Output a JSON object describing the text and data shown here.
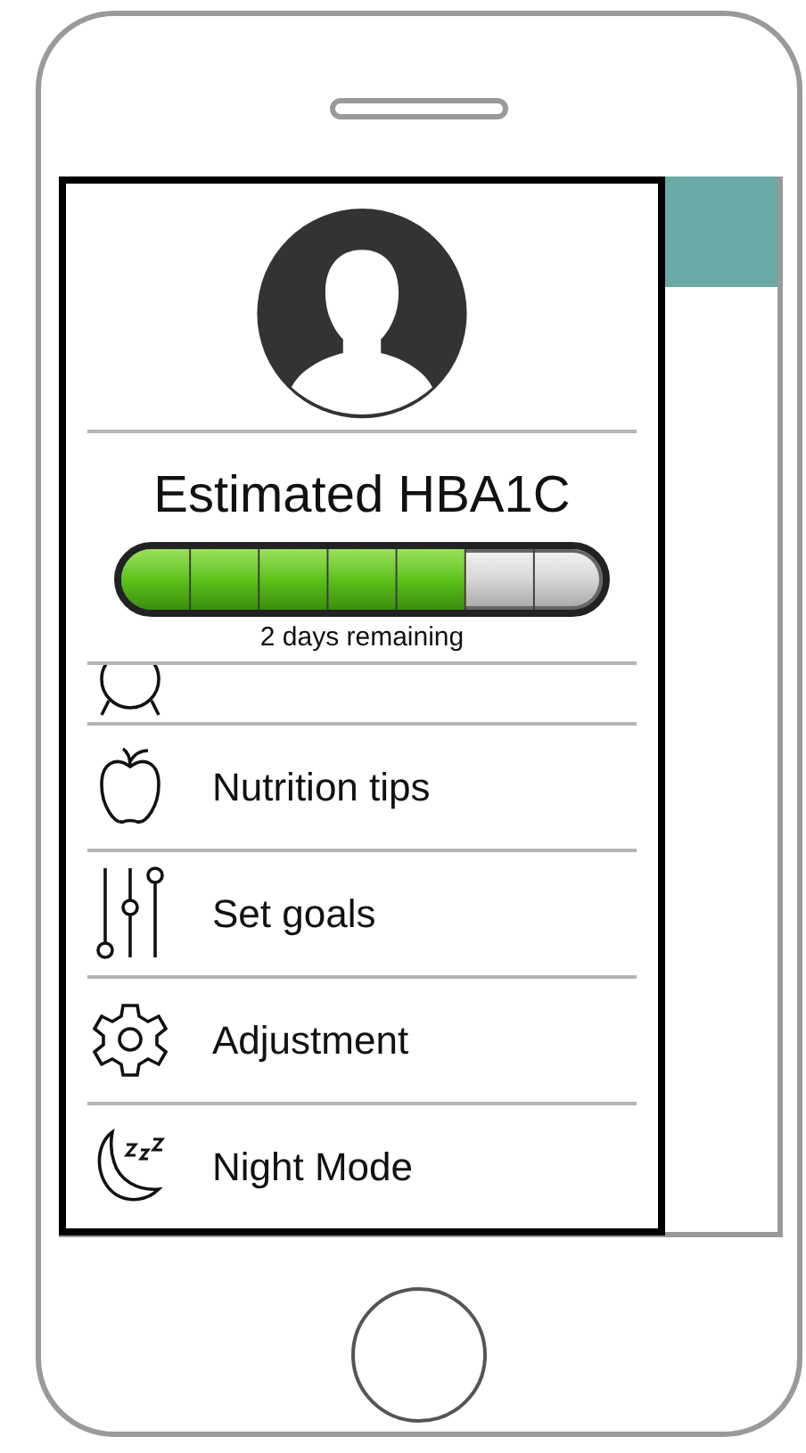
{
  "drawer": {
    "title": "Estimated HBA1C",
    "progress": {
      "level": 0.714
    },
    "caption": "2 days remaining",
    "items": [
      {
        "label": "Nutrition tips"
      },
      {
        "label": "Set goals"
      },
      {
        "label": "Adjustment"
      },
      {
        "label": "Night Mode"
      }
    ]
  }
}
